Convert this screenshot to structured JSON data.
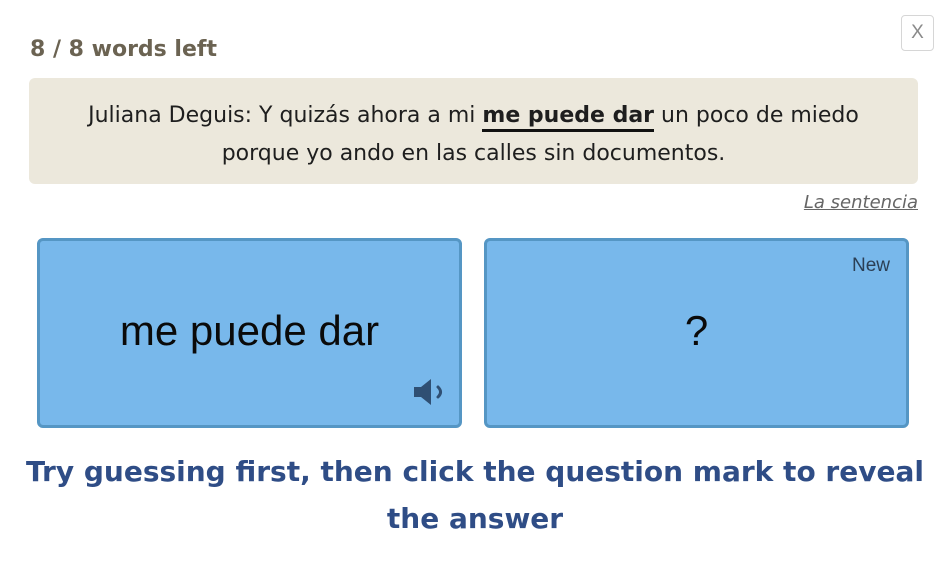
{
  "header": {
    "counter": "8 / 8 words left",
    "close_label": "X"
  },
  "sentence": {
    "before": "Juliana Deguis: Y quizás ahora a mi ",
    "highlight": "me puede dar",
    "after": " un poco de miedo porque yo ando en las calles sin documentos."
  },
  "sentence_link": "La sentencia",
  "cards": {
    "front": {
      "word": "me puede dar",
      "icon": "speaker-icon"
    },
    "back": {
      "badge": "New",
      "placeholder": "?"
    }
  },
  "hint": "Try guessing first, then click the question mark to reveal the answer",
  "colors": {
    "card_fill": "#78b8eb",
    "card_border": "#5596c4",
    "sentence_bg": "#ece8dc",
    "hint_text": "#2f4d86",
    "counter_text": "#6b6352"
  }
}
